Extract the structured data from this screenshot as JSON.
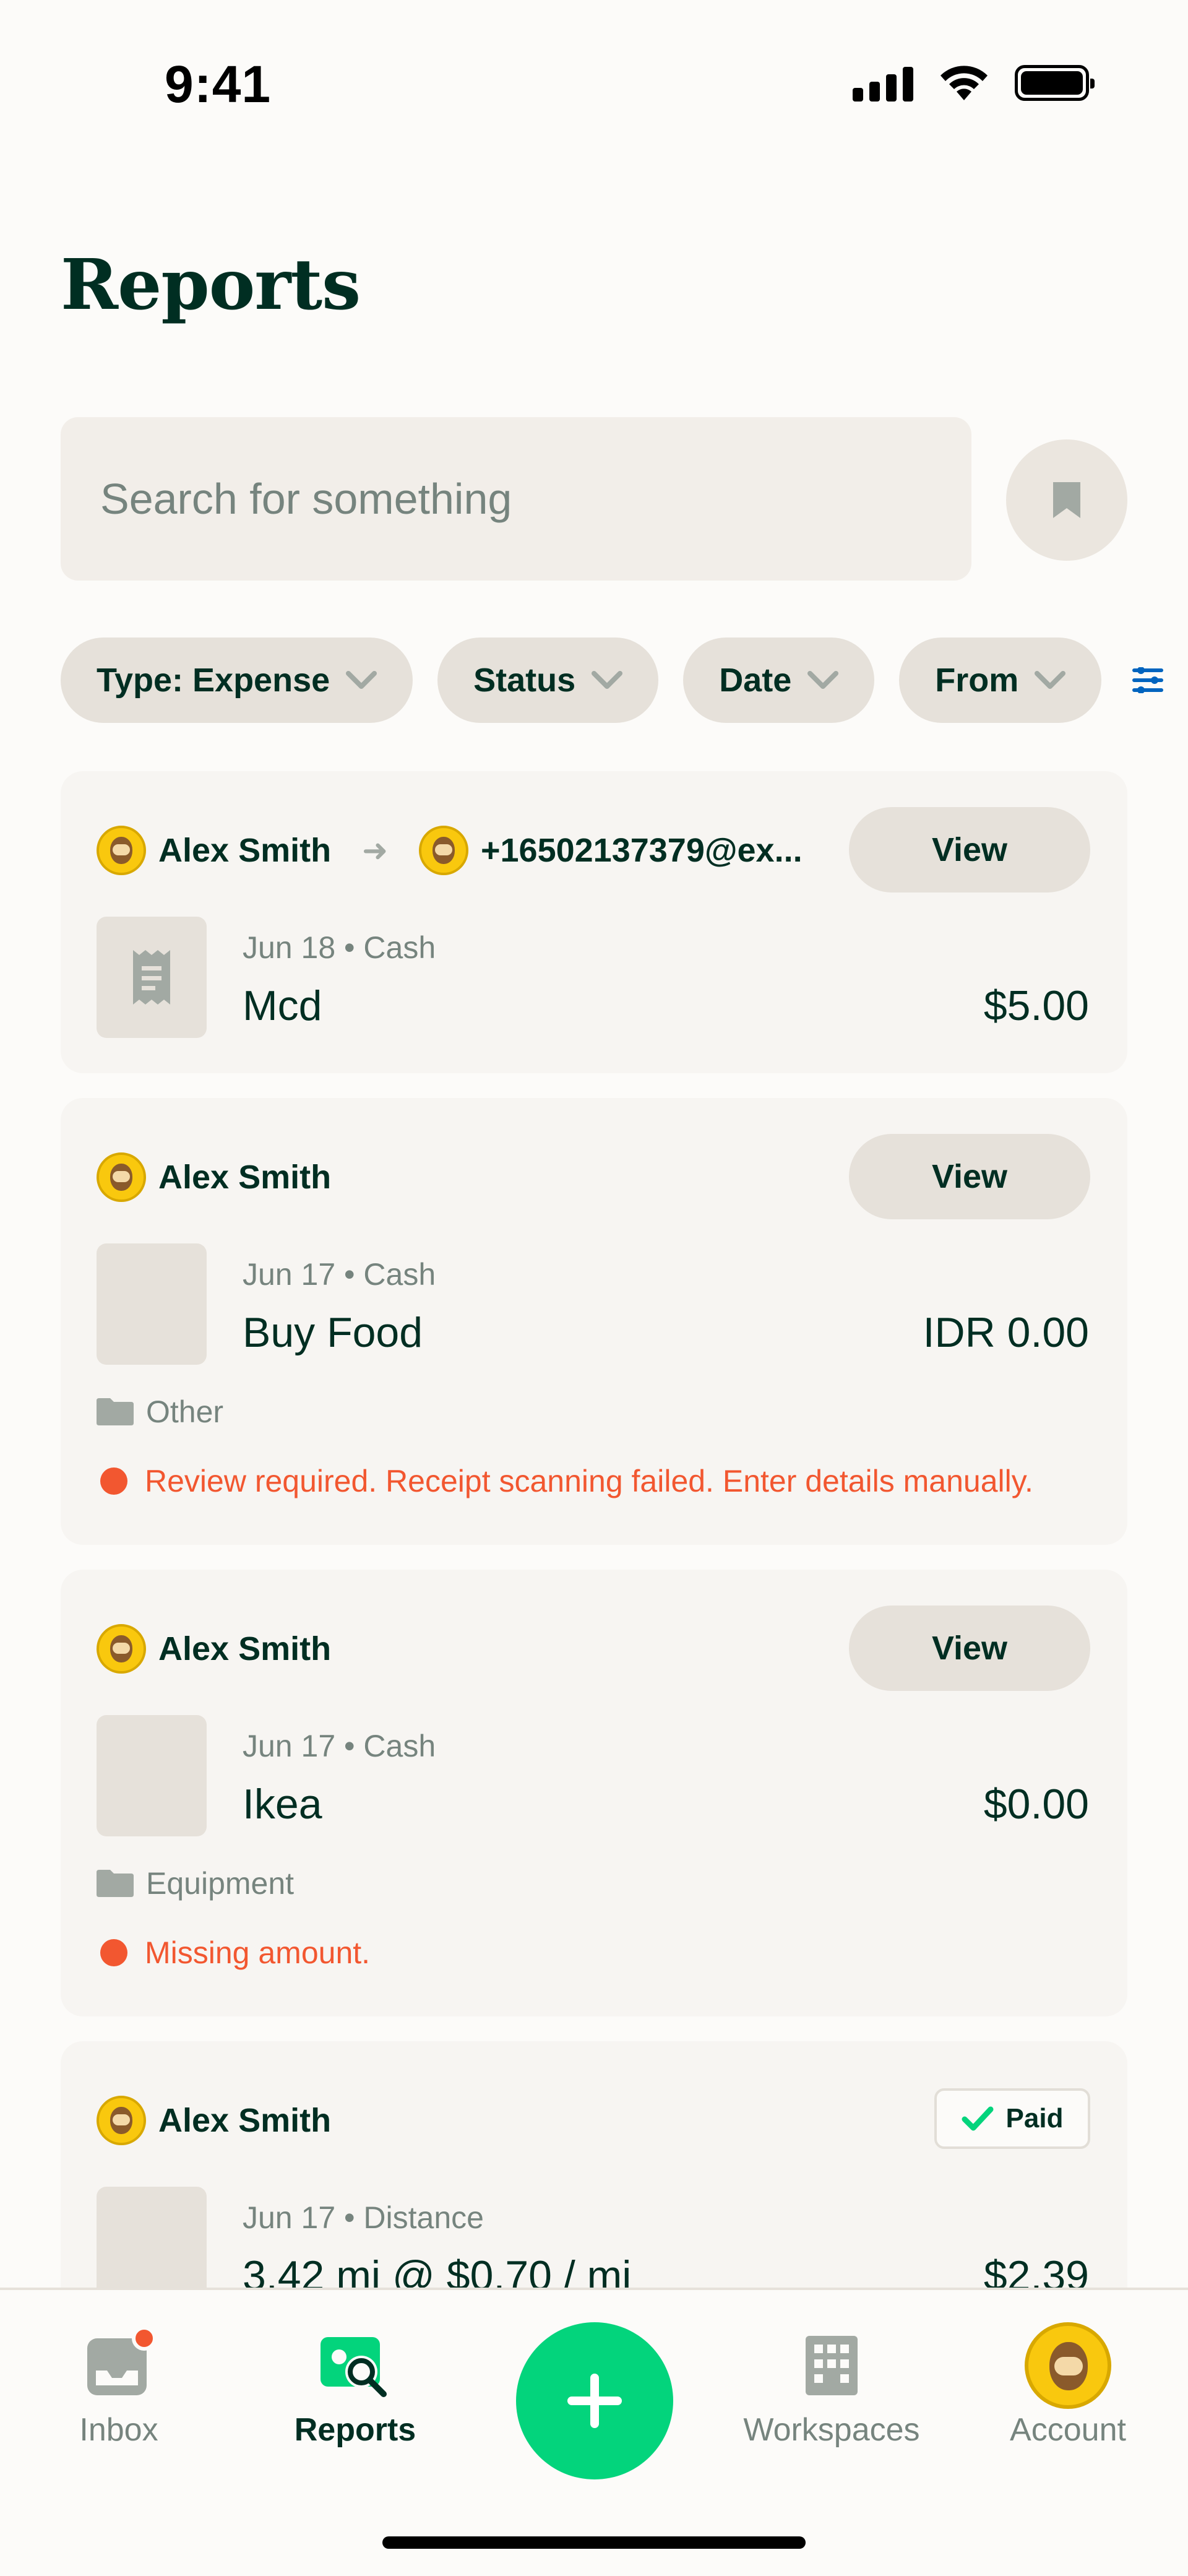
{
  "status_bar": {
    "time": "9:41"
  },
  "header": {
    "title": "Reports"
  },
  "search": {
    "placeholder": "Search for something"
  },
  "filters": [
    {
      "label": "Type: Expense"
    },
    {
      "label": "Status"
    },
    {
      "label": "Date"
    },
    {
      "label": "From"
    }
  ],
  "cards": [
    {
      "from": "Alex Smith",
      "to": "+16502137379@ex...",
      "action": "View",
      "meta": "Jun 18 • Cash",
      "merchant": "Mcd",
      "amount": "$5.00"
    },
    {
      "from": "Alex Smith",
      "action": "View",
      "meta": "Jun 17 • Cash",
      "merchant": "Buy Food",
      "amount": "IDR 0.00",
      "category": "Other",
      "error": "Review required. Receipt scanning failed. Enter details manually."
    },
    {
      "from": "Alex Smith",
      "action": "View",
      "meta": "Jun 17 • Cash",
      "merchant": "Ikea",
      "amount": "$0.00",
      "category": "Equipment",
      "error": "Missing amount."
    },
    {
      "from": "Alex Smith",
      "status": "Paid",
      "meta": "Jun 17 • Distance",
      "merchant": "3.42 mi @ $0.70 / mi",
      "amount": "$2.39"
    }
  ],
  "tabbar": {
    "inbox": "Inbox",
    "reports": "Reports",
    "workspaces": "Workspaces",
    "account": "Account"
  },
  "colors": {
    "accent_green": "#03D47C",
    "error_red": "#F25730",
    "text_dark": "#002E22",
    "text_muted": "#76847E"
  },
  "icons": [
    "signal-icon",
    "wifi-icon",
    "battery-icon",
    "bookmark-icon",
    "chevron-down-icon",
    "filter-icon",
    "receipt-icon",
    "folder-icon",
    "check-icon",
    "inbox-icon",
    "reports-icon",
    "plus-icon",
    "workspaces-icon",
    "account-avatar-icon"
  ]
}
